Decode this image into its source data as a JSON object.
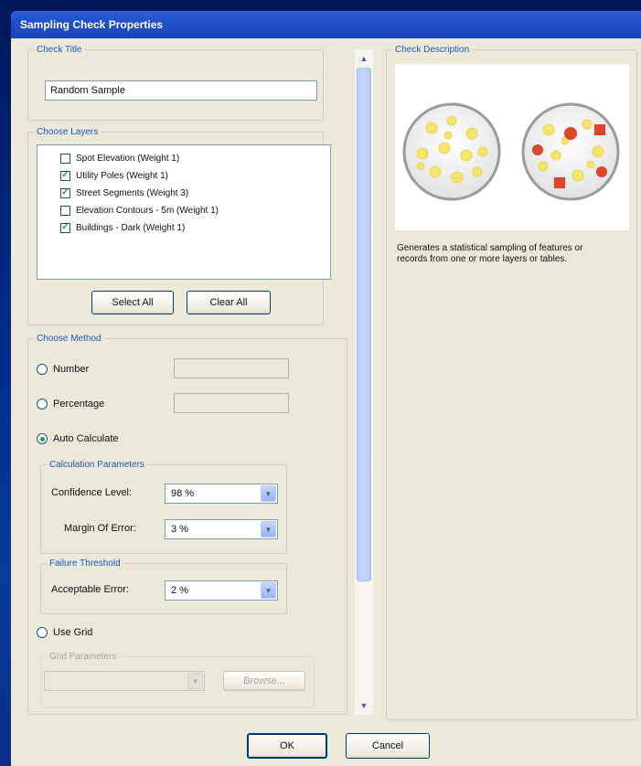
{
  "window": {
    "title": "Sampling Check Properties"
  },
  "check_title": {
    "label": "Check Title",
    "value": "Random Sample"
  },
  "layers": {
    "label": "Choose Layers",
    "items": [
      {
        "label": "Spot Elevation (Weight 1)",
        "checked": false
      },
      {
        "label": "Utility Poles (Weight 1)",
        "checked": true
      },
      {
        "label": "Street Segments (Weight 3)",
        "checked": true
      },
      {
        "label": "Elevation Contours - 5m (Weight 1)",
        "checked": false
      },
      {
        "label": "Buildings - Dark (Weight 1)",
        "checked": true
      }
    ],
    "select_all": "Select All",
    "clear_all": "Clear All"
  },
  "method": {
    "label": "Choose Method",
    "number": "Number",
    "percentage": "Percentage",
    "auto": "Auto Calculate",
    "selected": "auto",
    "calc_params": {
      "label": "Calculation Parameters",
      "confidence_label": "Confidence Level:",
      "confidence_value": "98 %",
      "margin_label": "Margin Of Error:",
      "margin_value": "3 %"
    },
    "failure": {
      "label": "Failure Threshold",
      "acceptable_label": "Acceptable Error:",
      "acceptable_value": "2 %"
    },
    "use_grid": "Use Grid",
    "grid_params": {
      "label": "Grid Parameters",
      "browse": "Browse..."
    }
  },
  "description": {
    "label": "Check Description",
    "text": "Generates a statistical sampling of features or records from one or more layers or tables."
  },
  "footer": {
    "ok": "OK",
    "cancel": "Cancel"
  },
  "colors": {
    "sample_yellow": "#f4e66a",
    "sample_red": "#e0442a",
    "accent": "#1f55c8"
  },
  "icons": {
    "scroll_up": "▲",
    "scroll_down": "▼",
    "combo": "▼",
    "check": "✓"
  }
}
